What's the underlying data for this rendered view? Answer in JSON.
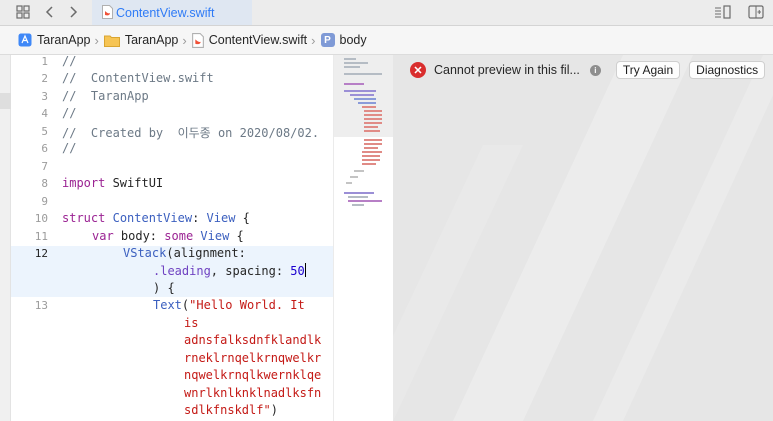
{
  "tab": {
    "label": "ContentView.swift"
  },
  "breadcrumb": [
    {
      "label": "TaranApp",
      "icon": "app-project-icon"
    },
    {
      "label": "TaranApp",
      "icon": "folder-icon"
    },
    {
      "label": "ContentView.swift",
      "icon": "swift-file-icon"
    },
    {
      "label": "body",
      "icon": "property-icon",
      "badge": "P"
    }
  ],
  "editor": {
    "current_line": 12,
    "line_numbers": [
      "1",
      "2",
      "3",
      "4",
      "5",
      "6",
      "7",
      "8",
      "9",
      "10",
      "11",
      "12",
      "13"
    ],
    "code": {
      "l1": "//",
      "l2": "//  ContentView.swift",
      "l3": "//  TaranApp",
      "l4": "//",
      "l5": "//  Created by  이두종 on 2020/08/02.",
      "l6": "//",
      "l8_kw": "import",
      "l8_rest": " SwiftUI",
      "l10_kw": "struct",
      "l10_name": "ContentView",
      "l10_colon": ": ",
      "l10_type": "View",
      "l10_brace": " {",
      "l11_var": "var",
      "l11_name": " body: ",
      "l11_some": "some",
      "l11_type": "View",
      "l11_brace": " {",
      "l12_type": "VStack",
      "l12_rest": "(alignment:",
      "l12b_member": ".leading",
      "l12b_rest": ", spacing: ",
      "l12b_num": "50",
      "l12c": ") {",
      "l13_type": "Text",
      "l13_paren": "(",
      "l13_str1": "\"Hello World. It",
      "l13_str2": "is",
      "l13_str3": "adnsfalksdnfklandlk",
      "l13_str4": "rneklrnqelkrnqwelkr",
      "l13_str5": "nqwelkrnqlkwernklqe",
      "l13_str6": "wnrlknlknklnadlksfn",
      "l13_str7": "sdlkfnskdlf\"",
      "l13_close": ")"
    }
  },
  "preview": {
    "error_text": "Cannot preview in this fil...",
    "try_again_label": "Try Again",
    "diagnostics_label": "Diagnostics"
  },
  "colors": {
    "accent": "#2f7bf6",
    "error": "#d92d2d",
    "keyword": "#9b2393",
    "string": "#c41a16"
  }
}
